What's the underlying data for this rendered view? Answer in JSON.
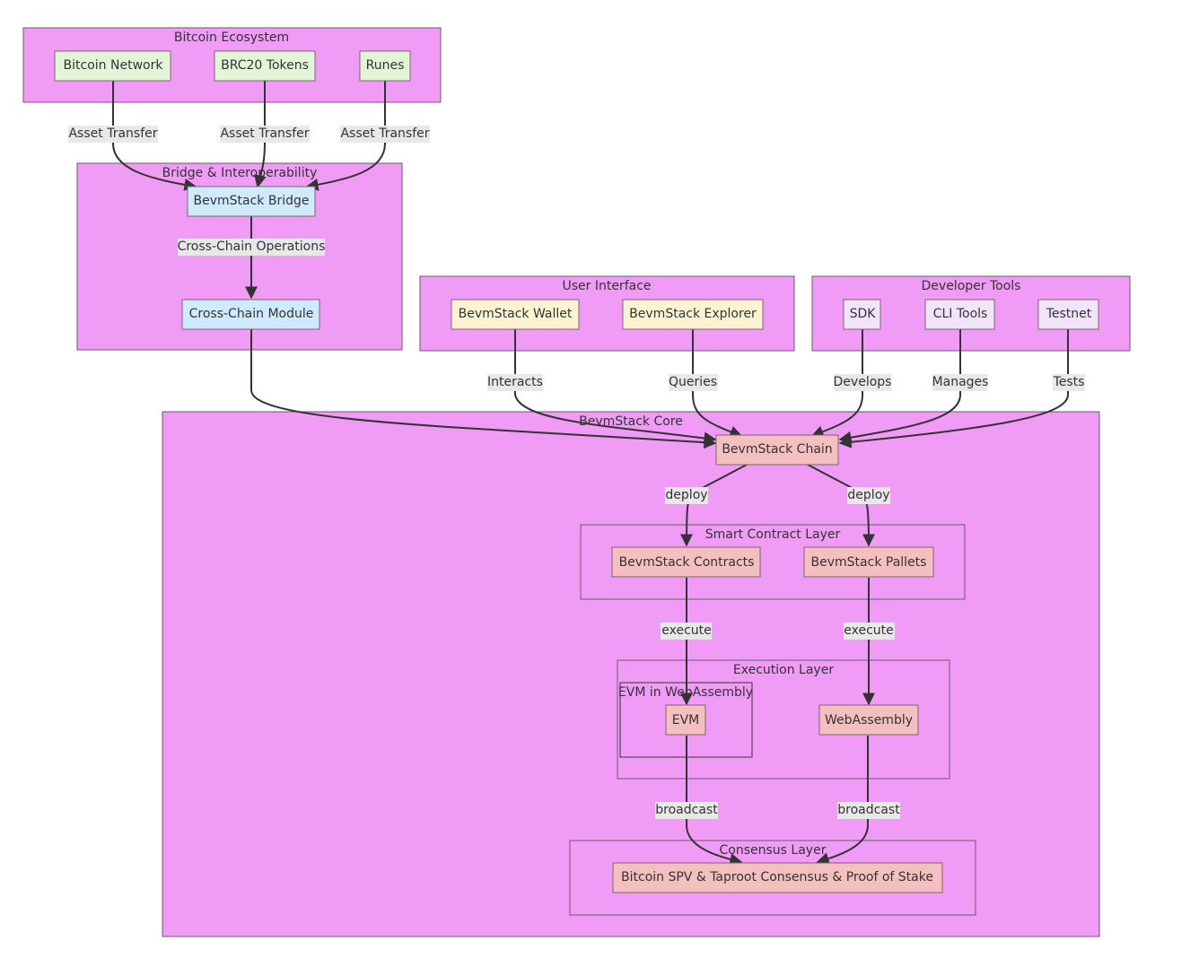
{
  "diagram": {
    "type": "flowchart",
    "colors": {
      "cluster_fill": "#f09bf5",
      "bitcoin_node": "#e2f5d8",
      "bridge_node": "#cfe9fd",
      "ui_node": "#fdf3d3",
      "dev_node": "#f0e4f9",
      "core_node": "#f4bfbf",
      "edge_label_bg": "#e8e8e8",
      "edge": "#333333"
    },
    "clusters": {
      "bitcoin": "Bitcoin Ecosystem",
      "bridge": "Bridge & Interoperability",
      "ui": "User Interface",
      "dev": "Developer Tools",
      "core": "BevmStack Core",
      "smart": "Smart Contract Layer",
      "exec": "Execution Layer",
      "evmwasm": "EVM in WebAssembly",
      "consensus": "Consensus Layer"
    },
    "nodes": {
      "btc_network": "Bitcoin Network",
      "brc20": "BRC20 Tokens",
      "runes": "Runes",
      "bridge": "BevmStack Bridge",
      "crosschain": "Cross-Chain Module",
      "wallet": "BevmStack Wallet",
      "explorer": "BevmStack Explorer",
      "sdk": "SDK",
      "cli": "CLI Tools",
      "testnet": "Testnet",
      "chain": "BevmStack Chain",
      "contracts": "BevmStack Contracts",
      "pallets": "BevmStack Pallets",
      "evm": "EVM",
      "wasm": "WebAssembly",
      "consensus": "Bitcoin SPV & Taproot Consensus & Proof of Stake"
    },
    "edges": {
      "e1": "Asset Transfer",
      "e2": "Asset Transfer",
      "e3": "Asset Transfer",
      "e4": "Cross-Chain Operations",
      "e5": "Interacts",
      "e6": "Queries",
      "e7": "Develops",
      "e8": "Manages",
      "e9": "Tests",
      "e10": "deploy",
      "e11": "deploy",
      "e12": "execute",
      "e13": "execute",
      "e14": "broadcast",
      "e15": "broadcast"
    }
  }
}
